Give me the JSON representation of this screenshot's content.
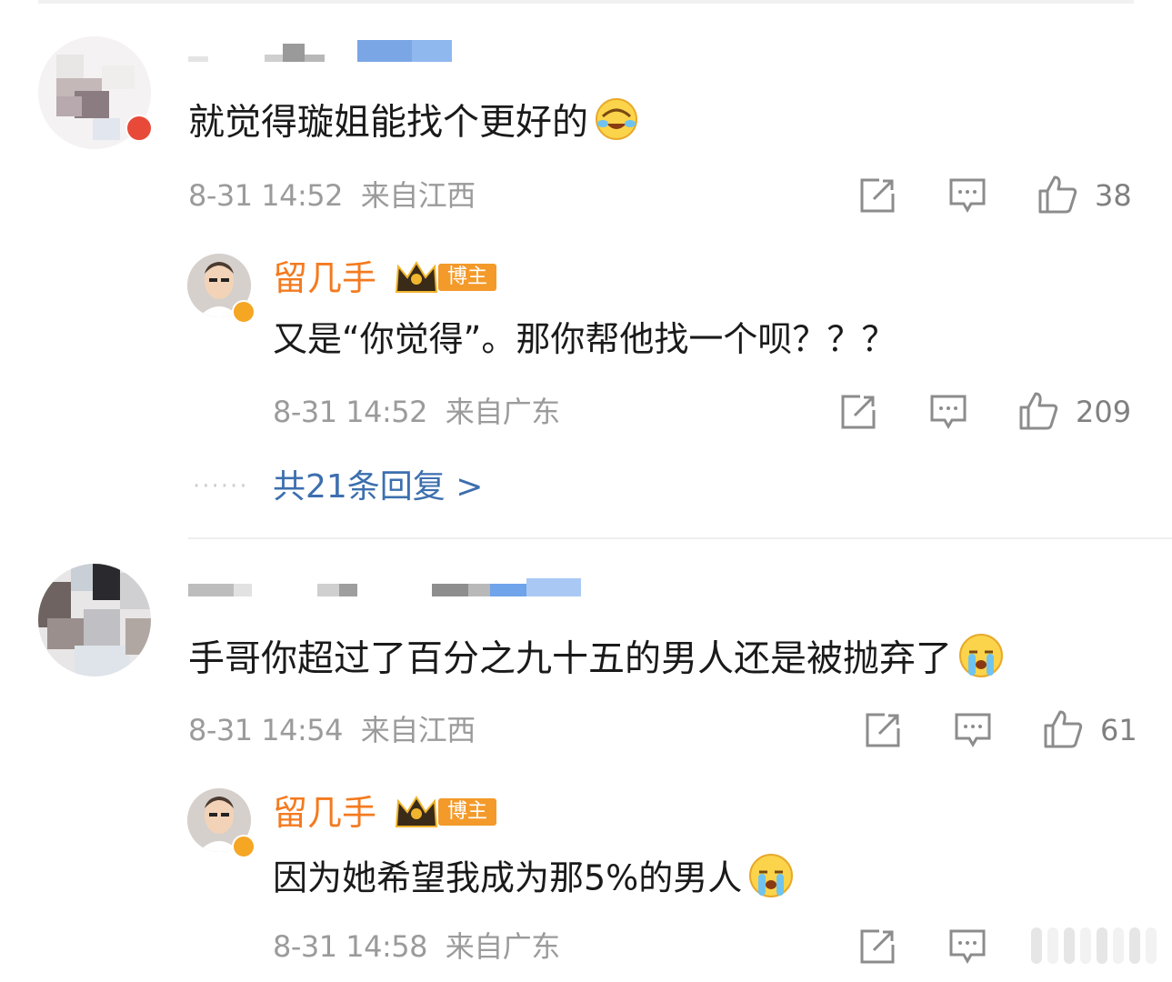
{
  "comments": [
    {
      "text": "就觉得璇姐能找个更好的",
      "emoji": "laughing-cry-emoji",
      "time": "8-31 14:52",
      "location": "来自江西",
      "likes": "38",
      "reply": {
        "author": "留几手",
        "badge": "博主",
        "text": "又是“你觉得”。那你帮他找一个呗？？？",
        "time": "8-31 14:52",
        "location": "来自广东",
        "likes": "209"
      },
      "more_replies": "共21条回复 >"
    },
    {
      "text": "手哥你超过了百分之九十五的男人还是被抛弃了",
      "emoji": "crying-emoji",
      "time": "8-31 14:54",
      "location": "来自江西",
      "likes": "61",
      "reply": {
        "author": "留几手",
        "badge": "博主",
        "text": "因为她希望我成为那5%的男人",
        "emoji": "crying-emoji",
        "time": "8-31 14:58",
        "location": "来自广东"
      }
    }
  ],
  "colors": {
    "author": "#f47a1f",
    "link": "#3d6fae",
    "meta": "#9b9b9b",
    "badge": "#f39a2a"
  }
}
